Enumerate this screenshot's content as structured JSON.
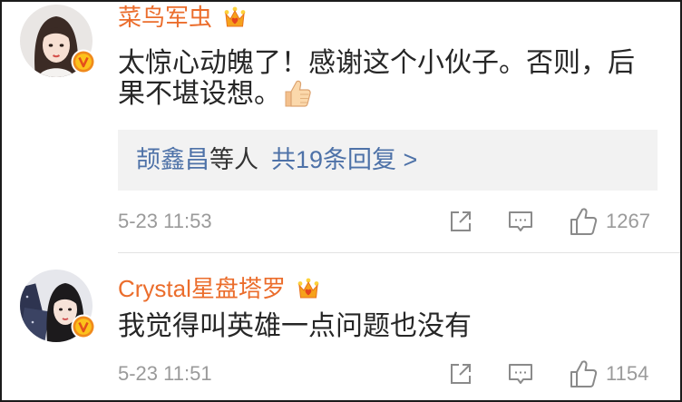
{
  "colors": {
    "username": "#eb6d2c",
    "link": "#4e72a8",
    "meta_text": "#9a9a9a",
    "icon_gray": "#8a8a8a",
    "reply_background": "#f2f2f2",
    "comment_text": "#262626"
  },
  "icons": {
    "vip": "vip-crown-icon",
    "verified": "verified-v-badge-icon",
    "share": "share-icon",
    "comment": "comment-icon",
    "like": "like-icon",
    "emoji": "thumbs-up-emoji-icon"
  },
  "comments": [
    {
      "username": "菜鸟军虫",
      "text": "太惊心动魄了！感谢这个小伙子。否则，后果不堪设想。",
      "replies": {
        "names": "颉鑫昌",
        "names_suffix": "等人",
        "count_label": "共19条回复 >"
      },
      "time": "5-23 11:53",
      "likes": "1267"
    },
    {
      "username": "Crystal星盘塔罗",
      "text": "我觉得叫英雄一点问题也没有",
      "time": "5-23 11:51",
      "likes": "1154"
    }
  ]
}
